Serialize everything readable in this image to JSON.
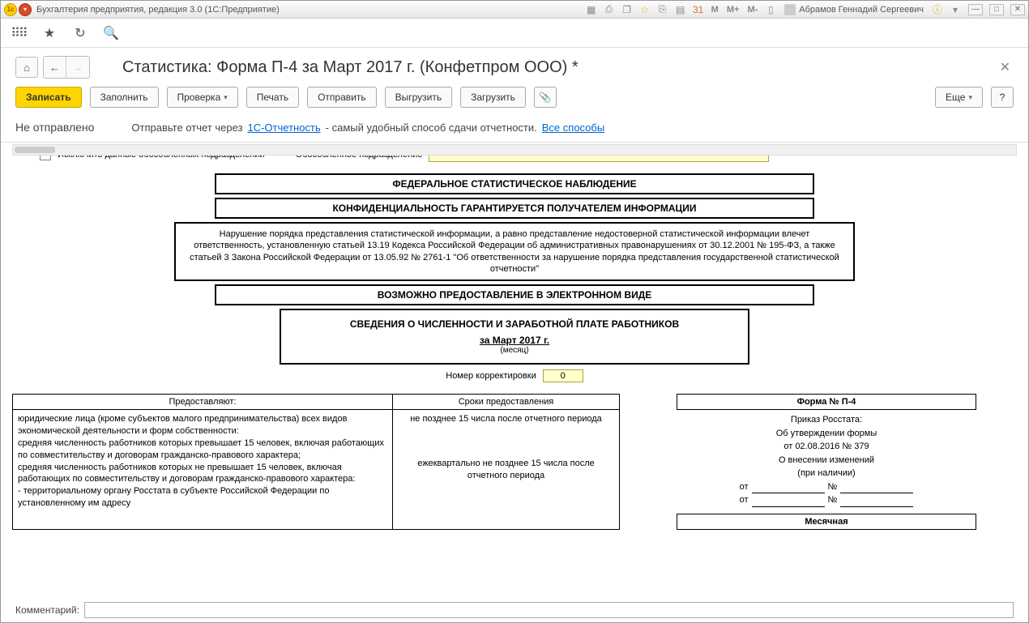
{
  "titleBar": {
    "appTitle": "Бухгалтерия предприятия, редакция 3.0  (1С:Предприятие)",
    "markers": {
      "m": "М",
      "mPlus": "М+",
      "mMinus": "М-"
    },
    "user": "Абрамов Геннадий Сергеевич"
  },
  "header": {
    "pageTitle": "Статистика: Форма П-4 за Март 2017 г. (Конфетпром ООО) *"
  },
  "actions": {
    "write": "Записать",
    "fill": "Заполнить",
    "check": "Проверка",
    "print": "Печать",
    "send": "Отправить",
    "export": "Выгрузить",
    "import": "Загрузить",
    "more": "Еще",
    "help": "?"
  },
  "status": {
    "label": "Не отправлено",
    "text1": "Отправьте отчет через ",
    "link1": "1С-Отчетность",
    "text2": " - самый удобный способ сдачи отчетности. ",
    "link2": "Все способы"
  },
  "form": {
    "excludeLabel": "Исключить данные обособленных подразделений",
    "obosLabel": "Обособленное подразделение",
    "box1": "ФЕДЕРАЛЬНОЕ СТАТИСТИЧЕСКОЕ НАБЛЮДЕНИЕ",
    "box2": "КОНФИДЕНЦИАЛЬНОСТЬ ГАРАНТИРУЕТСЯ ПОЛУЧАТЕЛЕМ ИНФОРМАЦИИ",
    "box3": "Нарушение порядка представления статистической информации, а равно представление недостоверной статистической информации влечет ответственность, установленную статьей 13.19 Кодекса Российской Федерации об административных правонарушениях от 30.12.2001 № 195-ФЗ, а также статьей 3 Закона Российской Федерации от 13.05.92 № 2761-1 \"Об ответственности за нарушение порядка представления государственной статистической отчетности\"",
    "box4": "ВОЗМОЖНО ПРЕДОСТАВЛЕНИЕ В ЭЛЕКТРОННОМ ВИДЕ",
    "box5Title": "СВЕДЕНИЯ О ЧИСЛЕННОСТИ И ЗАРАБОТНОЙ ПЛАТЕ РАБОТНИКОВ",
    "box5Period": "за Март 2017 г.",
    "box5Note": "(месяц)",
    "korrLabel": "Номер корректировки",
    "korrValue": "0",
    "colLeftHead": "Предоставляют:",
    "colLeftBody": "юридические лица (кроме субъектов малого предпринимательства) всех видов экономической деятельности и форм собственности:\n  средняя численность работников которых превышает 15 человек, включая работающих по совместительству и договорам гражданско-правового характера;\n  средняя численность работников которых не превышает 15 человек, включая работающих по совместительству и договорам гражданско-правового характера:\n   - территориальному органу Росстата в субъекте Российской Федерации по установленному им адресу",
    "colMidHead": "Сроки предоставления",
    "colMidBody1": "не позднее 15 числа после отчетного периода",
    "colMidBody2": "ежеквартально не позднее 15 числа после отчетного периода",
    "colRightHead": "Форма № П-4",
    "colRightL1": "Приказ Росстата:",
    "colRightL2": "Об утверждении формы",
    "colRightL3": "от 02.08.2016 № 379",
    "colRightL4": "О внесении изменений",
    "colRightL5": "(при наличии)",
    "ot": "от",
    "no": "№",
    "monthly": "Месячная"
  },
  "footer": {
    "commentLabel": "Комментарий:"
  }
}
